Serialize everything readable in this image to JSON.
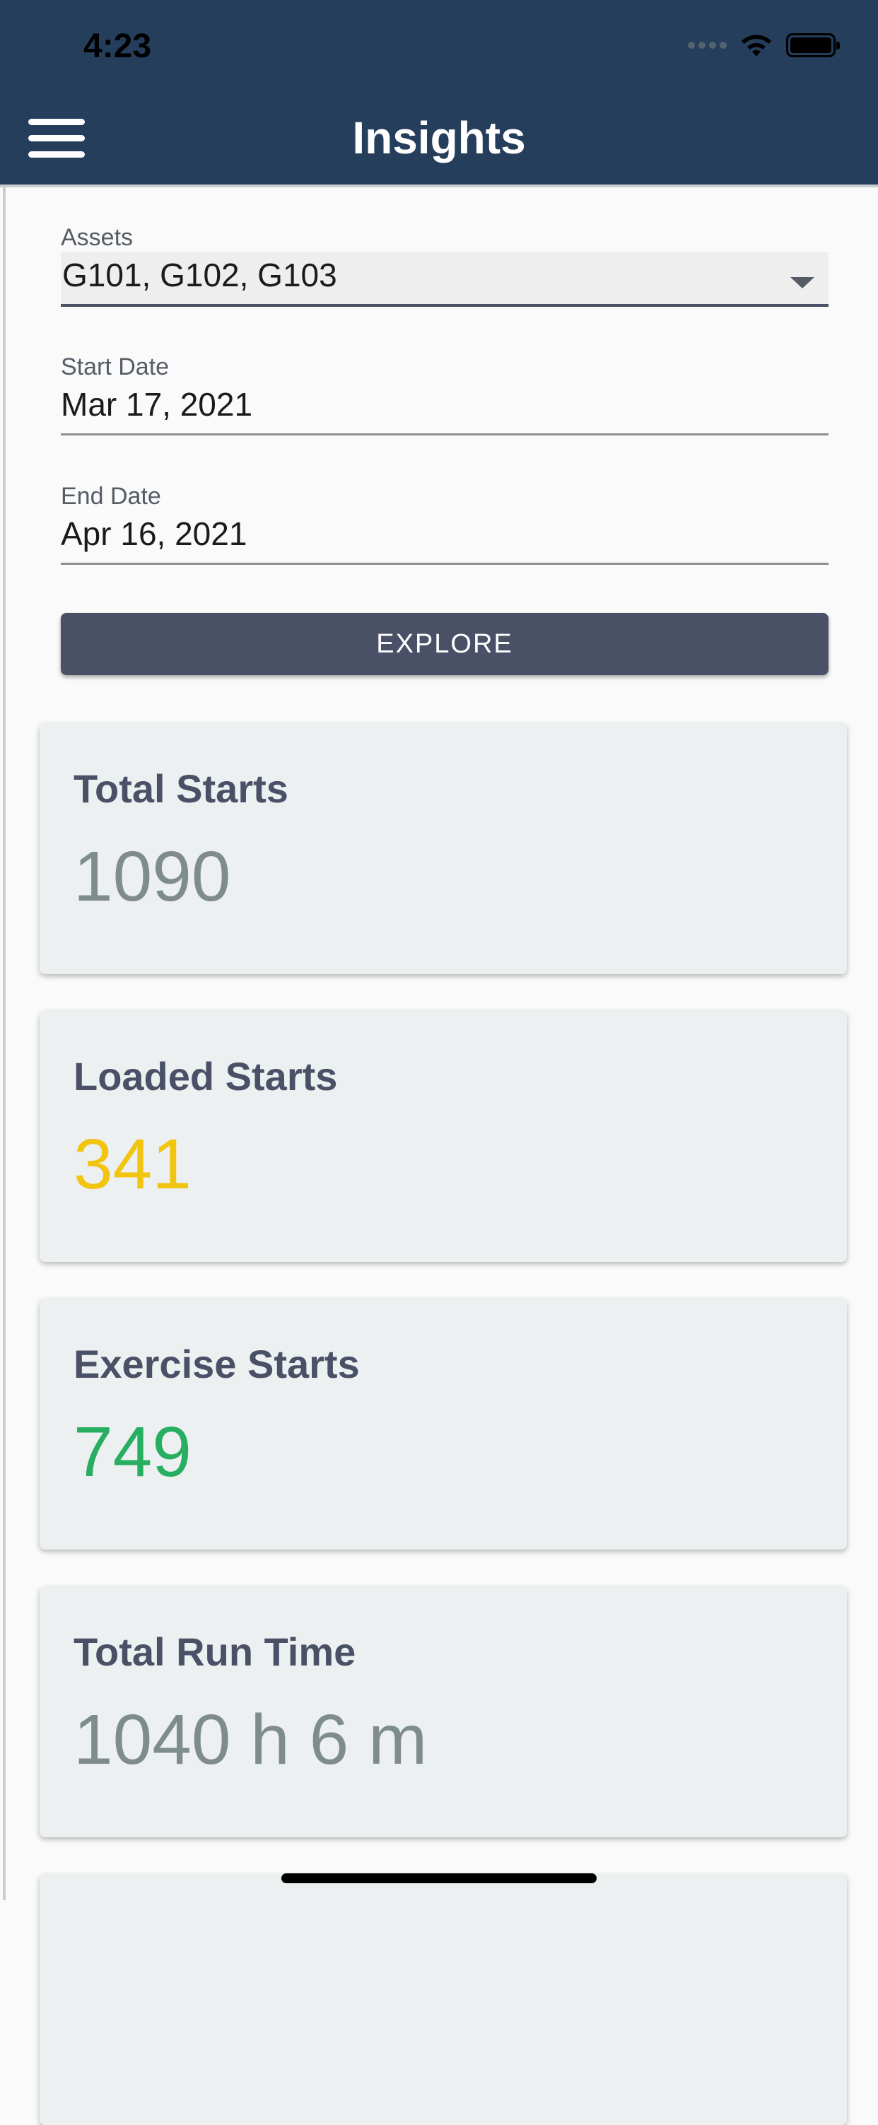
{
  "status_bar": {
    "time": "4:23"
  },
  "header": {
    "title": "Insights"
  },
  "form": {
    "assets": {
      "label": "Assets",
      "value": "G101, G102, G103"
    },
    "start_date": {
      "label": "Start Date",
      "value": "Mar 17, 2021"
    },
    "end_date": {
      "label": "End Date",
      "value": "Apr 16, 2021"
    },
    "explore_label": "EXPLORE"
  },
  "cards": [
    {
      "title": "Total Starts",
      "value": "1090",
      "color": "#7f8c8d"
    },
    {
      "title": "Loaded Starts",
      "value": "341",
      "color": "#f1c40f"
    },
    {
      "title": "Exercise Starts",
      "value": "749",
      "color": "#27ae60"
    },
    {
      "title": "Total Run Time",
      "value": "1040 h 6 m",
      "color": "#7f8c8d"
    }
  ],
  "colors": {
    "header_bg": "#243e5b",
    "button_bg": "#4a5167"
  }
}
